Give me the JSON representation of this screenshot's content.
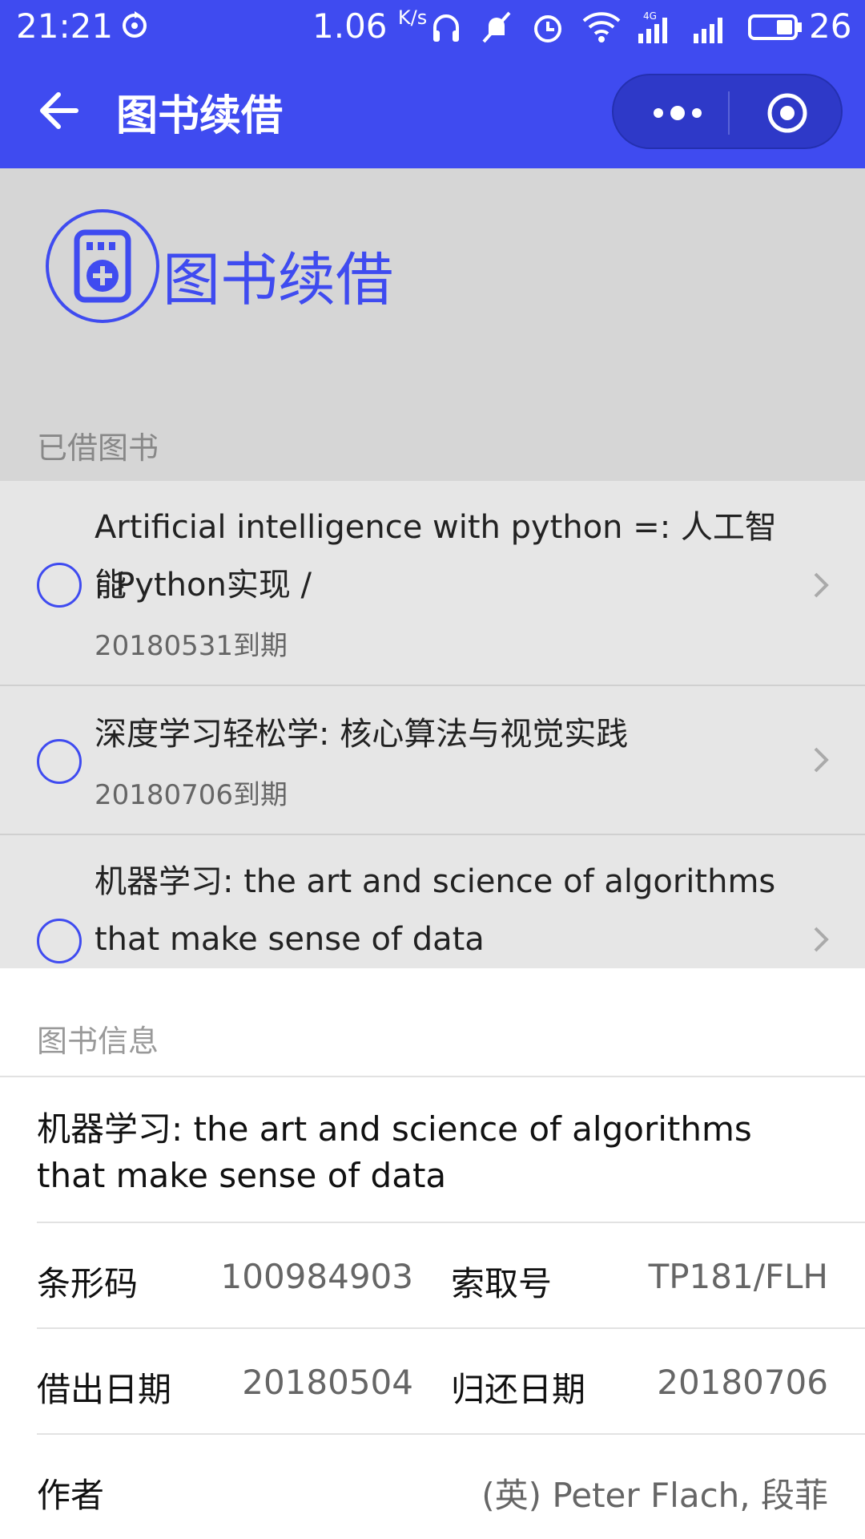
{
  "status_bar": {
    "time": "21:21",
    "speed": "1.06",
    "speed_unit": "K/s",
    "battery": "26",
    "icons": [
      "sync-icon",
      "headphones-icon",
      "mute-icon",
      "alarm-icon",
      "wifi-icon",
      "signal-4g-icon",
      "signal-icon",
      "battery-icon"
    ]
  },
  "nav": {
    "title": "图书续借",
    "back_icon": "back-arrow-icon",
    "more_icon": "more-dots-icon",
    "close_icon": "target-close-icon"
  },
  "colors": {
    "primary": "#3f4bf0",
    "overlay": "#d6d6d6",
    "list_bg": "#e6e6e6"
  },
  "hero": {
    "title": "图书续借",
    "icon": "book-renew-icon"
  },
  "borrowed": {
    "label": "已借图书",
    "items": [
      {
        "title_line1": "Artificial intelligence with python =: 人工智能",
        "title_line2": ": Python实现 /",
        "due": "20180531到期"
      },
      {
        "title_line1": "深度学习轻松学: 核心算法与视觉实践",
        "title_line2": "",
        "due": "20180706到期"
      },
      {
        "title_line1": "机器学习: the art and science of algorithms",
        "title_line2": "that make sense of data",
        "due": ""
      }
    ]
  },
  "book_info": {
    "label": "图书信息",
    "title": "机器学习: the art and science of algorithms that make sense of data",
    "barcode_label": "条形码",
    "barcode": "100984903",
    "callno_label": "索取号",
    "callno": "TP181/FLH",
    "borrow_date_label": "借出日期",
    "borrow_date": "20180504",
    "return_date_label": "归还日期",
    "return_date": "20180706",
    "author_label": "作者",
    "author": "(英) Peter Flach, 段菲"
  }
}
